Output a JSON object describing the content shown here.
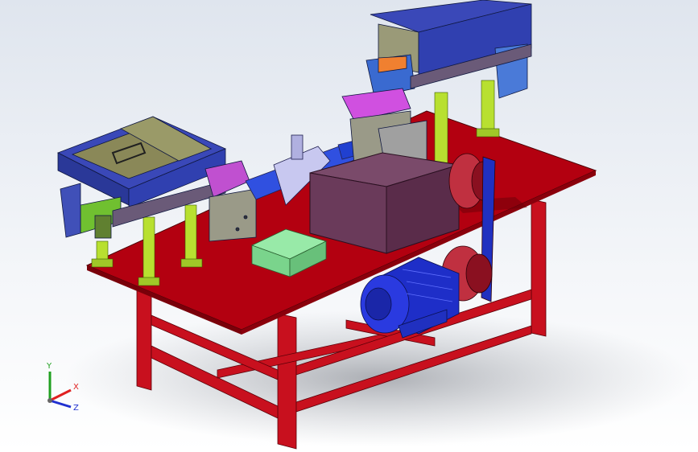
{
  "viewport": {
    "background": "#eef1f5"
  },
  "triad": {
    "y_label": "Y",
    "x_label": "X",
    "z_label": "Z",
    "x_color": "#e02020",
    "y_color": "#20a020",
    "z_color": "#2030d0"
  },
  "colors": {
    "table": "#b30010",
    "leg": "#c8101e",
    "feeder_body": "#3040b0",
    "motor": "#2233cc",
    "box": "#6a3a5a",
    "green_block": "#80e090"
  }
}
